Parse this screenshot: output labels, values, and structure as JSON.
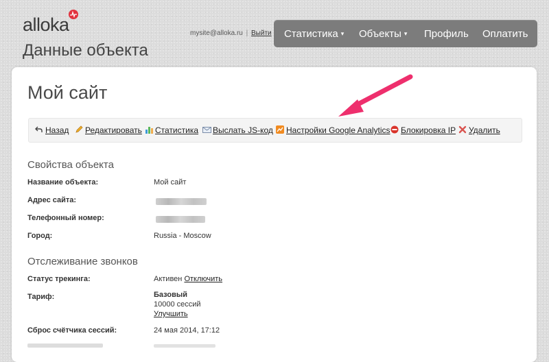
{
  "header": {
    "logo_text": "alloka",
    "page_heading": "Данные объекта",
    "account_email": "mysite@alloka.ru",
    "account_separator": "|",
    "logout_label": "Выйти"
  },
  "nav": {
    "items": [
      {
        "label": "Статистика",
        "dropdown": true
      },
      {
        "label": "Объекты",
        "dropdown": true
      },
      {
        "label": "Профиль",
        "dropdown": false
      },
      {
        "label": "Оплатить",
        "dropdown": false
      }
    ],
    "caret": "▾"
  },
  "main": {
    "title": "Мой сайт",
    "toolbar": [
      {
        "label": "Назад",
        "icon": "back-arrow-icon"
      },
      {
        "label": "Редактировать",
        "icon": "pencil-icon"
      },
      {
        "label": "Статистика",
        "icon": "bar-chart-icon"
      },
      {
        "label": "Выслать JS-код",
        "icon": "envelope-icon"
      },
      {
        "label": "Настройки Google Analytics",
        "icon": "analytics-icon"
      },
      {
        "label": "Блокировка IP",
        "icon": "block-icon"
      },
      {
        "label": "Удалить",
        "icon": "delete-x-icon"
      }
    ],
    "object_section": {
      "title": "Свойства объекта",
      "rows": [
        {
          "label": "Название объекта:",
          "value": "Мой сайт"
        },
        {
          "label": "Адрес сайта:",
          "value": ""
        },
        {
          "label": "Телефонный номер:",
          "value": ""
        },
        {
          "label": "Город:",
          "value": "Russia - Moscow"
        }
      ]
    },
    "tracking_section": {
      "title": "Отслеживание звонков",
      "status_label": "Статус трекинга:",
      "status_value": "Активен",
      "status_action": "Отключить",
      "tariff_label": "Тариф:",
      "tariff_name": "Базовый",
      "tariff_sessions": "10000 сессий",
      "tariff_action": "Улучшить",
      "reset_label": "Сброс счётчика сессий:",
      "reset_value": "24 мая 2014, 17:12"
    }
  },
  "colors": {
    "nav_bg": "#7c7c7c",
    "logo_accent": "#e2333f",
    "annotation_arrow": "#ee2f6d"
  }
}
